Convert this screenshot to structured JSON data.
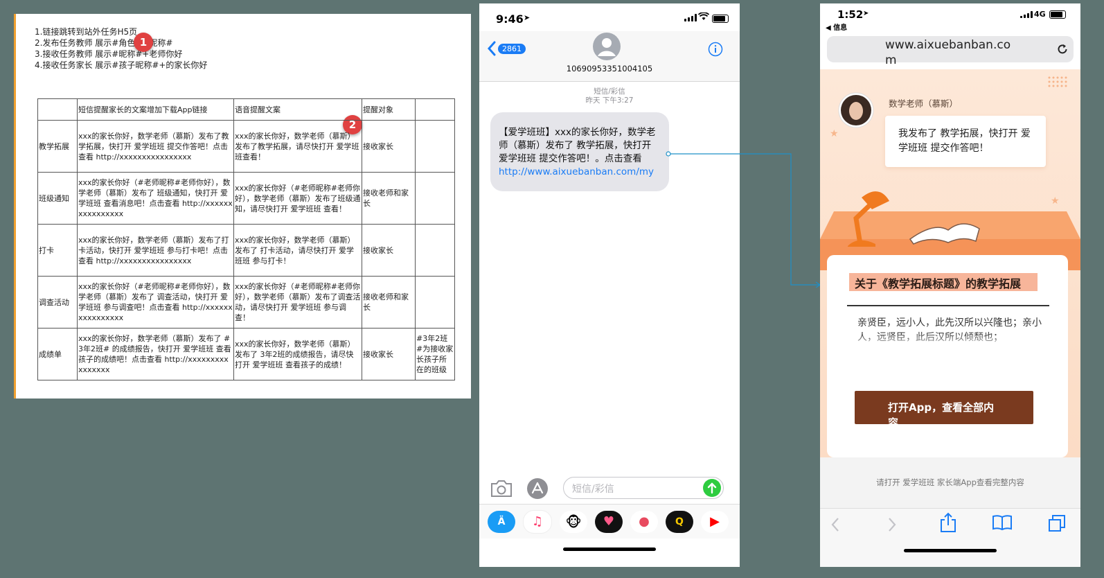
{
  "doc": {
    "notes": [
      "1.链接跳转到站外任务H5页",
      "2.发布任务教师 展示#角色##昵称#",
      "3.接收任务教师 展示#昵称#+老师你好",
      "4.接收任务家长 展示#孩子昵称#+的家长你好"
    ],
    "badges": [
      "1",
      "2"
    ],
    "table": {
      "headers": [
        "",
        "短信提醒家长的文案增加下载App链接",
        "语音提醒文案",
        "提醒对象",
        ""
      ],
      "rows": [
        [
          "教学拓展",
          "xxx的家长你好，数学老师（慕斯）发布了教学拓展，快打开 爱学班班 提交作答吧！点击查看 http://xxxxxxxxxxxxxxxx",
          "xxx的家长你好，数学老师（慕斯）发布了教学拓展，请尽快打开 爱学班班查看！",
          "接收家长",
          ""
        ],
        [
          "班级通知",
          "xxx的家长你好（#老师昵称#老师你好），数学老师（慕斯）发布了 班级通知，快打开 爱学班班 查看消息吧！点击查看 http://xxxxxxxxxxxxxxxx",
          "xxx的家长你好（#老师昵称#老师你好），数学老师（慕斯）发布了班级通知，请尽快打开 爱学班班 查看！",
          "接收老师和家长",
          ""
        ],
        [
          "打卡",
          "xxx的家长你好，数学老师（慕斯）发布了打卡活动，快打开 爱学班班 参与打卡吧！点击查看 http://xxxxxxxxxxxxxxxx",
          "xxx的家长你好，数学老师（慕斯）发布了 打卡活动，请尽快打开 爱学班班 参与打卡！",
          "接收家长",
          ""
        ],
        [
          "调查活动",
          "xxx的家长你好（#老师昵称#老师你好），数学老师（慕斯）发布了 调查活动，快打开 爱学班班 参与调查吧！点击查看 http://xxxxxxxxxxxxxxxx",
          "xxx的家长你好（#老师昵称#老师你好），数学老师（慕斯）发布了调查活动，请尽快打开 爱学班班 参与调查！",
          "接收老师和家长",
          ""
        ],
        [
          "成绩单",
          "xxx的家长你好，数学老师（慕斯）发布了 #3年2班# 的成绩报告，快打开 爱学班班 查看孩子的成绩吧！点击查看 http://xxxxxxxxxxxxxxxx",
          "xxx的家长你好，数学老师（慕斯）发布了 3年2班的成绩报告，请尽快打开 爱学班班 查看孩子的成绩！",
          "接收家长",
          "#3年2班#为接收家长孩子所在的班级"
        ]
      ]
    }
  },
  "phone1": {
    "time": "9:46",
    "back_count": "2861",
    "sender": "10690953351004105",
    "meta_type": "短信/彩信",
    "meta_time": "昨天 下午3:27",
    "message_text": "【爱学班班】xxx的家长你好，数学老师（慕斯）发布了 教学拓展，快打开 爱学班班 提交作答吧！。点击查看",
    "message_link": "http://www.aixuebanban.com/my",
    "input_placeholder": "短信/彩信"
  },
  "phone2": {
    "time": "1:52",
    "back_label": "◀ 信息",
    "network": "4G",
    "url": "www.aixuebanban.com",
    "teacher_name": "数学老师（慕斯）",
    "bubble_text": "我发布了 教学拓展，快打开 爱学班班 提交作答吧！",
    "card_title": "关于《教学拓展标题》的教学拓展",
    "card_body": "亲贤臣，远小人，此先汉所以兴隆也；亲小人，远贤臣，此后汉所以倾颓也；",
    "open_button": "打开App，查看全部内容",
    "footer_text": "请打开 爱学班班 家长端App查看完整内容"
  },
  "colors": {
    "background": "#5e7472",
    "ios_blue": "#1a7cf5",
    "accent_orange": "#f0a030",
    "button_brown": "#7a3a1f",
    "highlight": "#f7b59a"
  }
}
